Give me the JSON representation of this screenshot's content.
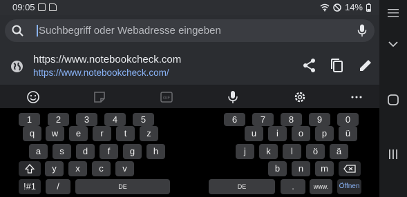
{
  "status_bar": {
    "time": "09:05",
    "battery": "14%"
  },
  "search": {
    "placeholder": "Suchbegriff oder Webadresse eingeben"
  },
  "suggestion": {
    "title": "https://www.notebookcheck.com",
    "url": "https://www.notebookcheck.com/"
  },
  "keyboard": {
    "row_numbers_left": [
      "1",
      "2",
      "3",
      "4",
      "5"
    ],
    "row_numbers_right": [
      "6",
      "7",
      "8",
      "9",
      "0"
    ],
    "row_q_left": [
      "q",
      "w",
      "e",
      "r",
      "t",
      "z"
    ],
    "row_q_right": [
      "u",
      "i",
      "o",
      "p",
      "ü"
    ],
    "row_a_left": [
      "a",
      "s",
      "d",
      "f",
      "g",
      "h"
    ],
    "row_a_right": [
      "j",
      "k",
      "l",
      "ö",
      "ä"
    ],
    "row_y_left": [
      "y",
      "x",
      "c",
      "v"
    ],
    "row_y_right": [
      "b",
      "n",
      "m"
    ],
    "symbols_label": "!#1",
    "slash_label": "/",
    "space_left_label": "DE",
    "space_right_label": "DE",
    "period_label": ".",
    "www_label": "www.",
    "enter_label": "Öffnen"
  },
  "icons": {
    "status_left": [
      "image-icon",
      "clipboard-icon"
    ],
    "status_right": [
      "wifi-icon",
      "do-not-disturb-icon",
      "battery-icon"
    ],
    "toolbar": [
      "emoji-icon",
      "sticker-icon",
      "gif-icon",
      "microphone-icon",
      "settings-icon",
      "more-icon"
    ],
    "nav": [
      "grip-icon",
      "chevron-down-icon",
      "home-icon",
      "recents-icon"
    ]
  },
  "colors": {
    "accent": "#8ab4f8"
  }
}
